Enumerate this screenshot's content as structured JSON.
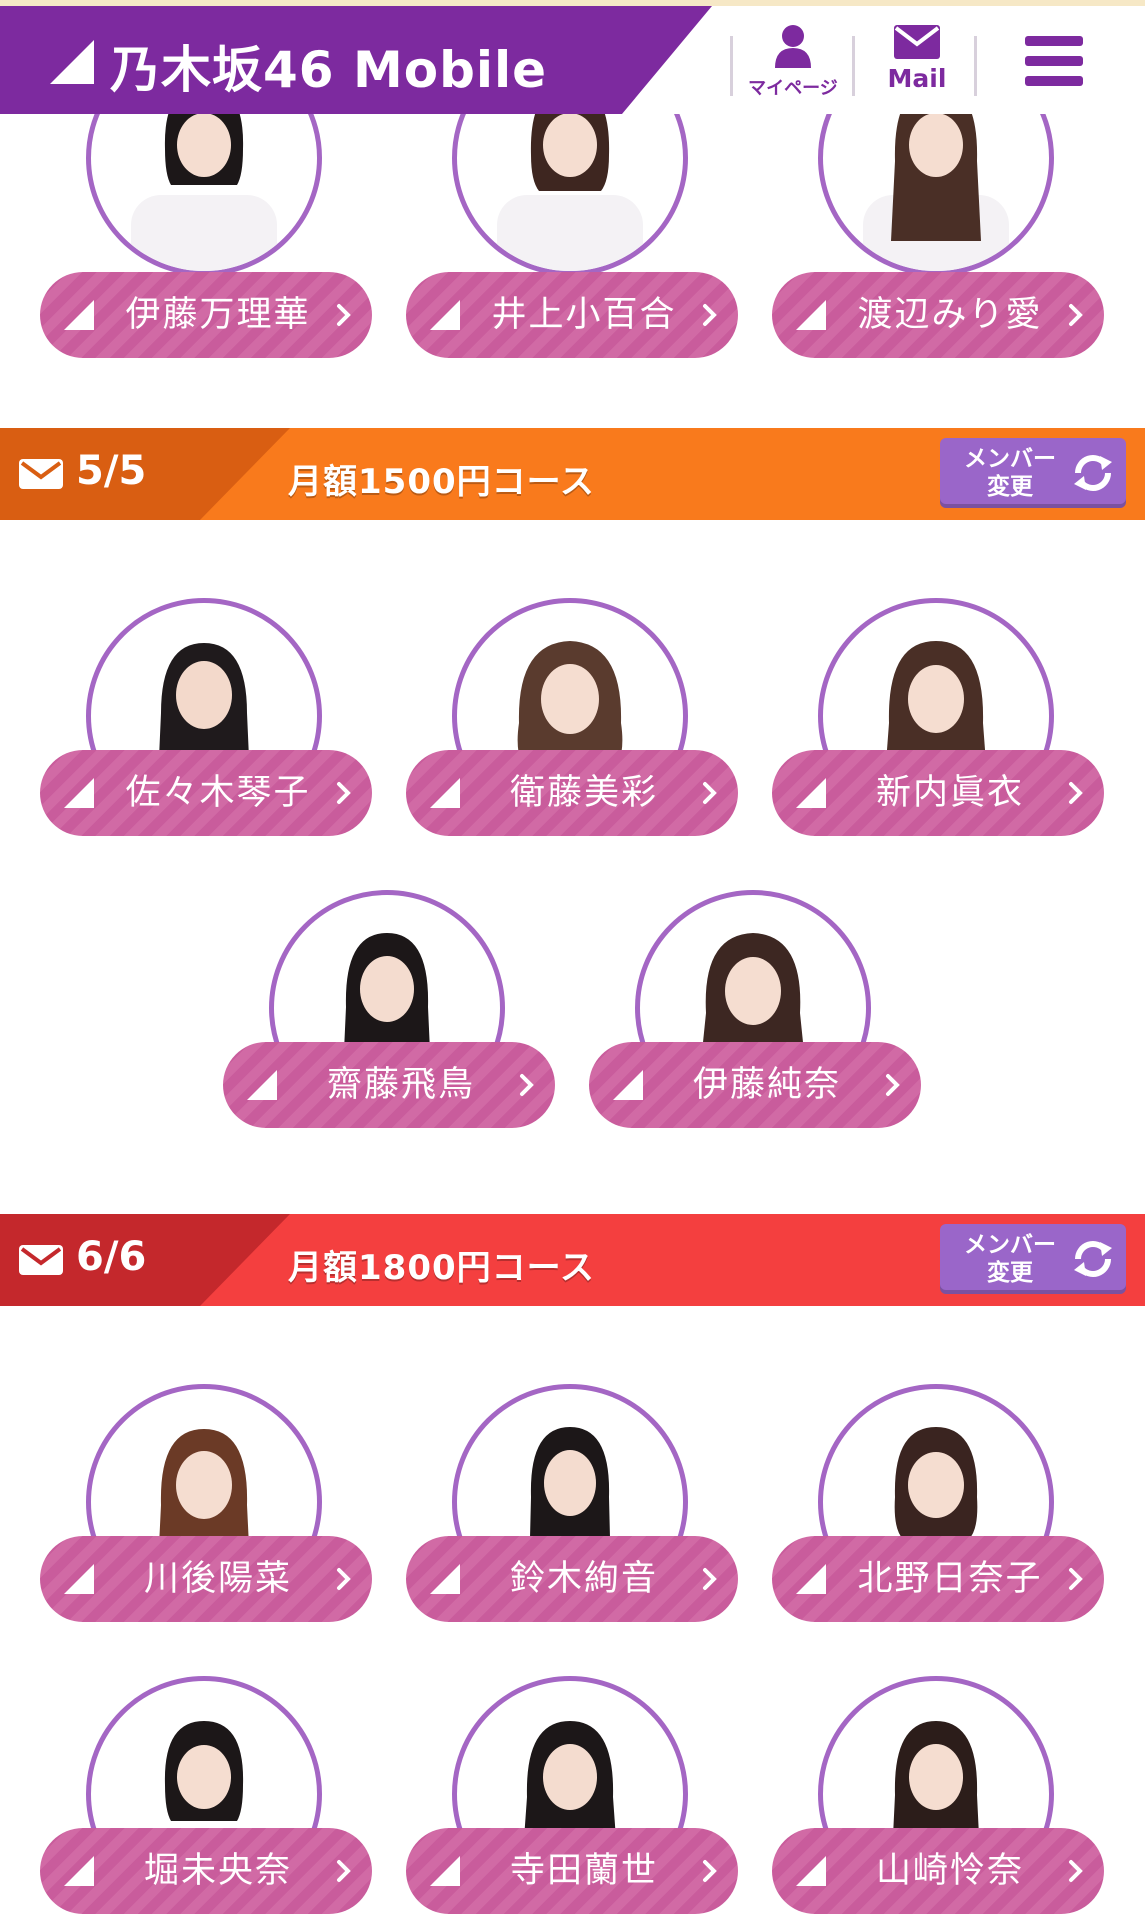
{
  "header": {
    "brand": "乃木坂46 Mobile",
    "mypage_label": "マイページ",
    "mail_label": "Mail",
    "colors": {
      "brand_purple": "#7d2a9f"
    }
  },
  "top_members": [
    {
      "name": "伊藤万理華",
      "photo": "member-photo"
    },
    {
      "name": "井上小百合",
      "photo": "member-photo"
    },
    {
      "name": "渡辺みり愛",
      "photo": "member-photo"
    }
  ],
  "course_1500": {
    "count": "5/5",
    "name": "月額1500円コース",
    "change_line1": "メンバー",
    "change_line2": "変更",
    "colors": {
      "left": "#d95e12",
      "right": "#f97a1c"
    },
    "members": [
      {
        "name": "佐々木琴子"
      },
      {
        "name": "衛藤美彩"
      },
      {
        "name": "新内眞衣"
      },
      {
        "name": "齋藤飛鳥"
      },
      {
        "name": "伊藤純奈"
      }
    ]
  },
  "course_1800": {
    "count": "6/6",
    "name": "月額1800円コース",
    "change_line1": "メンバー",
    "change_line2": "変更",
    "colors": {
      "left": "#c4282c",
      "right": "#f43f3f"
    },
    "members": [
      {
        "name": "川後陽菜"
      },
      {
        "name": "鈴木絢音"
      },
      {
        "name": "北野日奈子"
      },
      {
        "name": "堀未央奈"
      },
      {
        "name": "寺田蘭世"
      },
      {
        "name": "山崎怜奈"
      }
    ]
  }
}
